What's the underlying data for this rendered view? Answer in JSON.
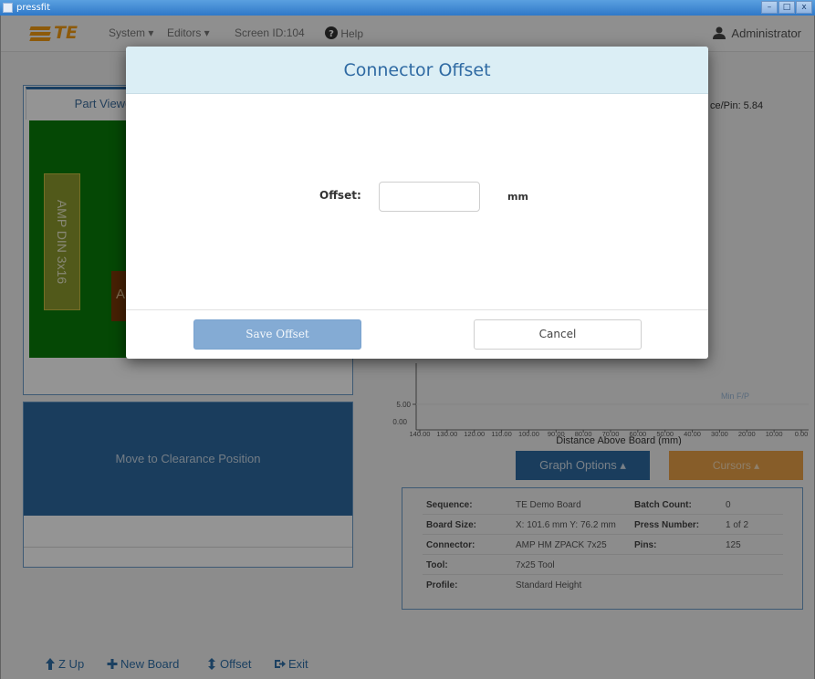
{
  "window": {
    "title": "pressfit",
    "controls": [
      "–",
      "□",
      "x"
    ]
  },
  "navbar": {
    "brand": "TE",
    "items": [
      "System ▾",
      "Editors ▾",
      "Screen ID:104",
      "Help"
    ],
    "user": "Administrator"
  },
  "part_view": {
    "tab_label": "Part Viewe",
    "connector1": "AMP DIN 3x16",
    "connector2": "A"
  },
  "move_button": "Move to Clearance Position",
  "ce_pin": "ce/Pin: 5.84",
  "chart_data": {
    "type": "line",
    "xlabel": "Distance Above Board (mm)",
    "x_ticks": [
      "140.00",
      "130.00",
      "120.00",
      "110.00",
      "100.00",
      "90.00",
      "80.00",
      "70.00",
      "60.00",
      "50.00",
      "40.00",
      "30.00",
      "20.00",
      "10.00",
      "0.00"
    ],
    "y_ticks": [
      "5.00",
      "0.00"
    ],
    "annotation": "Min F/P",
    "series": []
  },
  "buttons": {
    "graph_options": "Graph Options ▴",
    "cursors": "Cursors ▴"
  },
  "info": [
    {
      "k1": "Sequence:",
      "v1": "TE Demo Board",
      "k2": "Batch Count:",
      "v2": "0"
    },
    {
      "k1": "Board Size:",
      "v1": "X: 101.6 mm  Y: 76.2 mm",
      "k2": "Press Number:",
      "v2": "1 of 2"
    },
    {
      "k1": "Connector:",
      "v1": "AMP HM ZPACK 7x25",
      "k2": "Pins:",
      "v2": "125"
    },
    {
      "k1": "Tool:",
      "v1": "7x25 Tool",
      "k2": "",
      "v2": ""
    },
    {
      "k1": "Profile:",
      "v1": "Standard Height",
      "k2": "",
      "v2": ""
    }
  ],
  "bottom_bar": {
    "z_up": "Z Up",
    "new_board": "New Board",
    "offset": "Offset",
    "exit": "Exit"
  },
  "modal": {
    "title": "Connector Offset",
    "offset_label": "Offset:",
    "offset_value": "",
    "unit": "mm",
    "save_label": "Save Offset",
    "cancel_label": "Cancel"
  },
  "colors": {
    "accent_blue": "#2d6aa0",
    "brand_orange": "#f39c12",
    "cursor_orange": "#e8a048",
    "board_green": "#0a7d0a"
  }
}
